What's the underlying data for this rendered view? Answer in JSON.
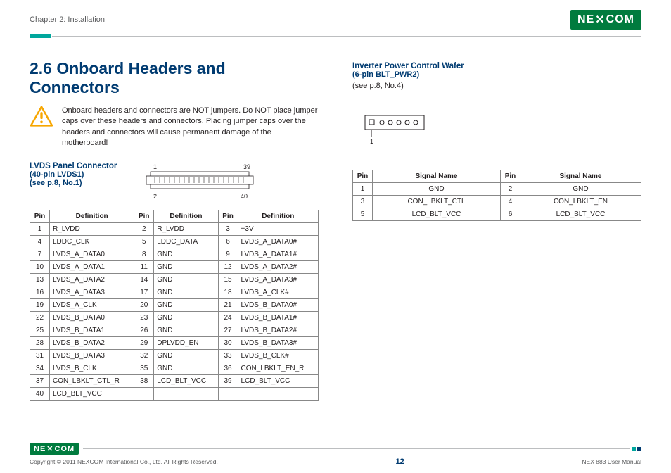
{
  "header": {
    "chapter": "Chapter 2: Installation",
    "brand": "NE COM"
  },
  "section": {
    "title": "2.6 Onboard Headers and Connectors",
    "warning": "Onboard headers and connectors are NOT jumpers. Do NOT place jumper caps over these headers and connectors. Placing jumper caps over the headers and connectors will cause permanent damage of the motherboard!"
  },
  "lvds": {
    "heading": "LVDS Panel Connector",
    "sub": "(40-pin LVDS1)",
    "ref": "(see p.8, No.1)",
    "diagram": {
      "tl": "1",
      "tr": "39",
      "bl": "2",
      "br": "40"
    },
    "cols": [
      "Pin",
      "Definition",
      "Pin",
      "Definition",
      "Pin",
      "Definition"
    ],
    "rows": [
      [
        "1",
        "R_LVDD",
        "2",
        "R_LVDD",
        "3",
        "+3V"
      ],
      [
        "4",
        "LDDC_CLK",
        "5",
        "LDDC_DATA",
        "6",
        "LVDS_A_DATA0#"
      ],
      [
        "7",
        "LVDS_A_DATA0",
        "8",
        "GND",
        "9",
        "LVDS_A_DATA1#"
      ],
      [
        "10",
        "LVDS_A_DATA1",
        "11",
        "GND",
        "12",
        "LVDS_A_DATA2#"
      ],
      [
        "13",
        "LVDS_A_DATA2",
        "14",
        "GND",
        "15",
        "LVDS_A_DATA3#"
      ],
      [
        "16",
        "LVDS_A_DATA3",
        "17",
        "GND",
        "18",
        "LVDS_A_CLK#"
      ],
      [
        "19",
        "LVDS_A_CLK",
        "20",
        "GND",
        "21",
        "LVDS_B_DATA0#"
      ],
      [
        "22",
        "LVDS_B_DATA0",
        "23",
        "GND",
        "24",
        "LVDS_B_DATA1#"
      ],
      [
        "25",
        "LVDS_B_DATA1",
        "26",
        "GND",
        "27",
        "LVDS_B_DATA2#"
      ],
      [
        "28",
        "LVDS_B_DATA2",
        "29",
        "DPLVDD_EN",
        "30",
        "LVDS_B_DATA3#"
      ],
      [
        "31",
        "LVDS_B_DATA3",
        "32",
        "GND",
        "33",
        "LVDS_B_CLK#"
      ],
      [
        "34",
        "LVDS_B_CLK",
        "35",
        "GND",
        "36",
        "CON_LBKLT_EN_R"
      ],
      [
        "37",
        "CON_LBKLT_CTL_R",
        "38",
        "LCD_BLT_VCC",
        "39",
        "LCD_BLT_VCC"
      ],
      [
        "40",
        "LCD_BLT_VCC",
        "",
        "",
        "",
        ""
      ]
    ]
  },
  "wafer": {
    "heading": "Inverter Power Control Wafer",
    "sub": "(6-pin BLT_PWR2)",
    "ref": "(see p.8, No.4)",
    "pinlabel": "1",
    "cols": [
      "Pin",
      "Signal Name",
      "Pin",
      "Signal Name"
    ],
    "rows": [
      [
        "1",
        "GND",
        "2",
        "GND"
      ],
      [
        "3",
        "CON_LBKLT_CTL",
        "4",
        "CON_LBKLT_EN"
      ],
      [
        "5",
        "LCD_BLT_VCC",
        "6",
        "LCD_BLT_VCC"
      ]
    ]
  },
  "footer": {
    "copyright": "Copyright © 2011 NEXCOM International Co., Ltd. All Rights Reserved.",
    "pagenum": "12",
    "docid": "NEX 883 User Manual"
  }
}
